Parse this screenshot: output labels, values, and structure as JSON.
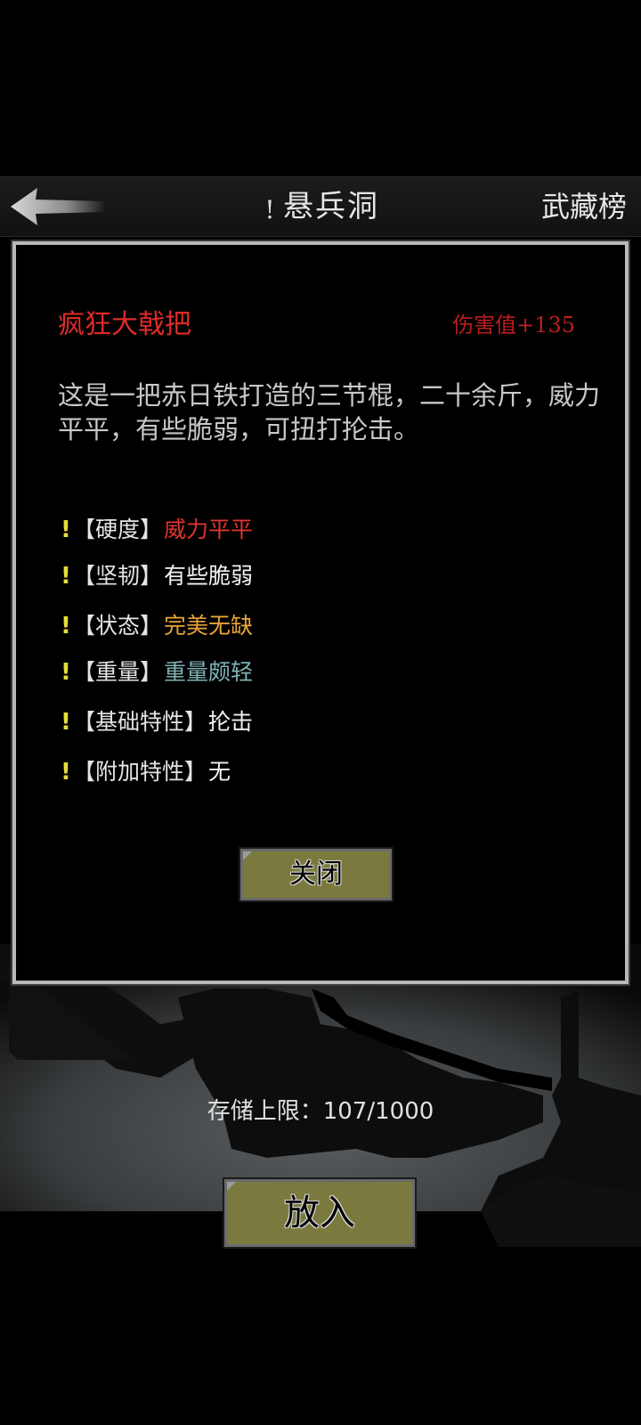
{
  "header": {
    "title_icon": "!",
    "title": "悬兵洞",
    "right_link": "武藏榜",
    "back_icon": "arrow-left-icon"
  },
  "item": {
    "name": "疯狂大戟把",
    "damage": "伤害值+135",
    "description": "这是一把赤日铁打造的三节棍，二十余斤，威力平平，有些脆弱，可扭打抡击。",
    "attributes": [
      {
        "mark": "!",
        "key": "【硬度】",
        "value": "威力平平",
        "color": "#e0332e"
      },
      {
        "mark": "!",
        "key": "【坚韧】",
        "value": "有些脆弱",
        "color": "#f2f2f2"
      },
      {
        "mark": "!",
        "key": "【状态】",
        "value": "完美无缺",
        "color": "#e8a33a"
      },
      {
        "mark": "!",
        "key": "【重量】",
        "value": "重量颇轻",
        "color": "#7fb3b5"
      },
      {
        "mark": "!",
        "key": "【基础特性】",
        "value": "抡击",
        "color": "#f2f2f2"
      },
      {
        "mark": "!",
        "key": "【附加特性】",
        "value": "无",
        "color": "#f2f2f2"
      }
    ],
    "close_label": "关闭"
  },
  "storage": {
    "label": "存储上限：107/1000"
  },
  "put_button": {
    "label": "放入"
  },
  "colors": {
    "button_fill": "#7a7a3e",
    "panel_border": "#b8b8b8",
    "item_name": "#e02a2a",
    "damage": "#b81f1f",
    "mark": "#e6dd3a"
  }
}
